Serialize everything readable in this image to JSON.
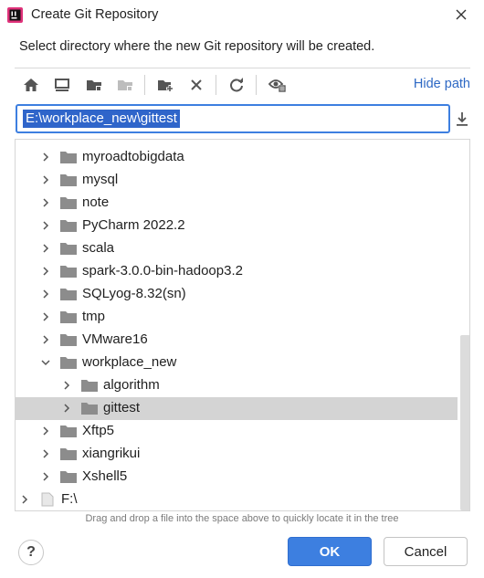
{
  "window": {
    "title": "Create Git Repository"
  },
  "dialog": {
    "subtitle": "Select directory where the new Git repository will be created.",
    "hide_path_label": "Hide path",
    "path_value": "E:\\workplace_new\\gittest",
    "drag_hint": "Drag and drop a file into the space above to quickly locate it in the tree"
  },
  "toolbar": {
    "icons": [
      "home-icon",
      "desktop-icon",
      "project-folder-icon",
      "module-folder-icon",
      "new-folder-icon",
      "delete-icon",
      "refresh-icon",
      "show-hidden-icon"
    ]
  },
  "tree": {
    "items": [
      {
        "label": "myroadtobigdata",
        "level": 1,
        "expanded": false,
        "selected": false
      },
      {
        "label": "mysql",
        "level": 1,
        "expanded": false,
        "selected": false
      },
      {
        "label": "note",
        "level": 1,
        "expanded": false,
        "selected": false
      },
      {
        "label": "PyCharm 2022.2",
        "level": 1,
        "expanded": false,
        "selected": false
      },
      {
        "label": "scala",
        "level": 1,
        "expanded": false,
        "selected": false
      },
      {
        "label": "spark-3.0.0-bin-hadoop3.2",
        "level": 1,
        "expanded": false,
        "selected": false
      },
      {
        "label": "SQLyog-8.32(sn)",
        "level": 1,
        "expanded": false,
        "selected": false
      },
      {
        "label": "tmp",
        "level": 1,
        "expanded": false,
        "selected": false
      },
      {
        "label": "VMware16",
        "level": 1,
        "expanded": false,
        "selected": false
      },
      {
        "label": "workplace_new",
        "level": 1,
        "expanded": true,
        "selected": false
      },
      {
        "label": "algorithm",
        "level": 2,
        "expanded": false,
        "selected": false
      },
      {
        "label": "gittest",
        "level": 2,
        "expanded": false,
        "selected": true
      },
      {
        "label": "Xftp5",
        "level": 1,
        "expanded": false,
        "selected": false
      },
      {
        "label": "xiangrikui",
        "level": 1,
        "expanded": false,
        "selected": false
      },
      {
        "label": "Xshell5",
        "level": 1,
        "expanded": false,
        "selected": false
      },
      {
        "label": "F:\\",
        "level": 0,
        "expanded": false,
        "selected": false,
        "drive": true
      }
    ]
  },
  "buttons": {
    "help_label": "?",
    "ok_label": "OK",
    "cancel_label": "Cancel"
  },
  "colors": {
    "accent": "#3d7fe0",
    "link": "#2d68c4",
    "selection_text_bg": "#2f65ca",
    "selected_row": "#d4d4d4",
    "folder": "#8c8c8c"
  }
}
